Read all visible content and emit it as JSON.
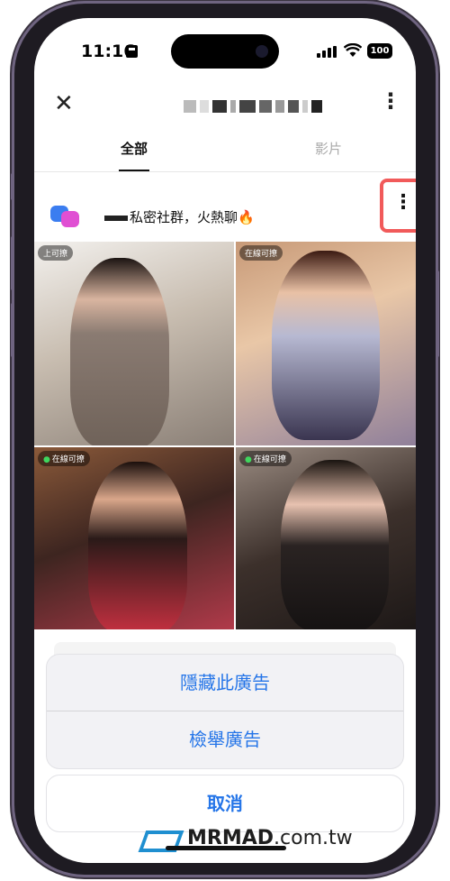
{
  "status": {
    "time": "11:16",
    "battery": "100"
  },
  "header": {
    "close_icon": "close-icon",
    "more_icon": "more-vertical-icon"
  },
  "tabs": [
    {
      "label": "全部",
      "active": true
    },
    {
      "label": "影片",
      "active": false
    }
  ],
  "ad": {
    "name": "私密社群，火熱聊🔥",
    "menu_icon": "more-vertical-icon"
  },
  "tiles": [
    {
      "badge": "上可撩",
      "dot": false
    },
    {
      "badge": "在線可撩",
      "dot": false
    },
    {
      "badge": "在線可撩",
      "dot": true
    },
    {
      "badge": "在線可撩",
      "dot": true
    }
  ],
  "sheet": {
    "hide_ad": "隱藏此廣告",
    "report_ad": "檢舉廣告",
    "cancel": "取消"
  },
  "watermark": {
    "brand": "MRMAD",
    "domain": ".com.tw"
  },
  "colors": {
    "accent": "#2575e8",
    "highlight": "#f15a5a"
  }
}
